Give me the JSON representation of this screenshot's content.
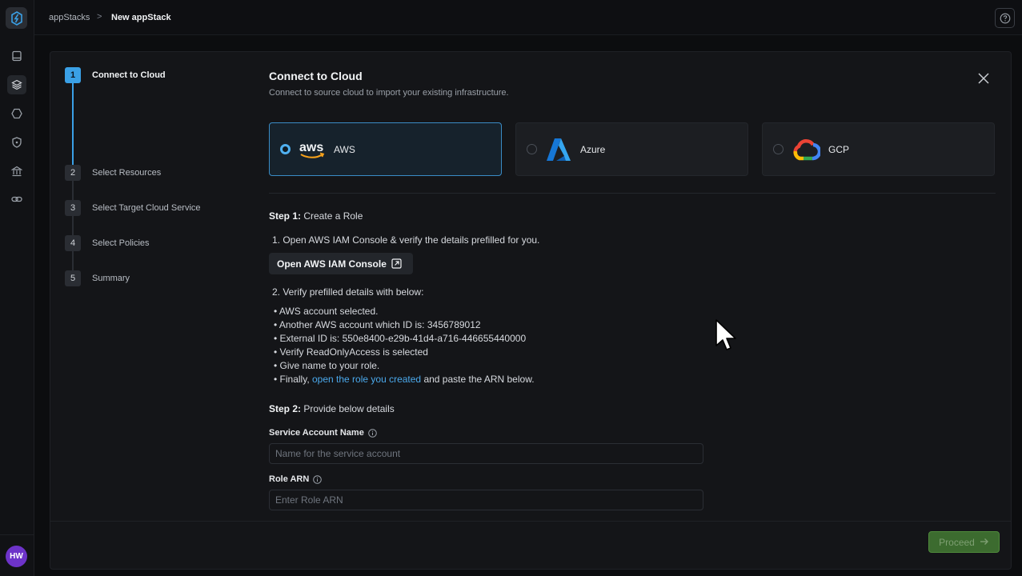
{
  "breadcrumb": {
    "root": "appStacks",
    "separator": ">",
    "current": "New appStack"
  },
  "user": {
    "initials": "HW"
  },
  "stepper": {
    "steps": [
      {
        "num": "1",
        "label": "Connect to Cloud",
        "active": true
      },
      {
        "num": "2",
        "label": "Select Resources"
      },
      {
        "num": "3",
        "label": "Select Target Cloud Service"
      },
      {
        "num": "4",
        "label": "Select Policies"
      },
      {
        "num": "5",
        "label": "Summary"
      }
    ]
  },
  "header": {
    "title": "Connect to Cloud",
    "subtitle": "Connect to source cloud to import your existing infrastructure."
  },
  "clouds": [
    {
      "name": "AWS",
      "logo_text": "aws",
      "selected": true
    },
    {
      "name": "Azure",
      "selected": false
    },
    {
      "name": "GCP",
      "selected": false
    }
  ],
  "step1": {
    "heading_bold": "Step 1:",
    "heading_rest": " Create a Role",
    "item1": "1. Open AWS IAM Console & verify the details prefilled for you.",
    "console_button": "Open AWS IAM Console",
    "item2": "2. Verify prefilled details with below:",
    "bullets": [
      "AWS account selected.",
      "Another AWS account which ID is: 3456789012",
      "External ID is: 550e8400-e29b-41d4-a716-446655440000",
      "Verify ReadOnlyAccess is selected",
      "Give name to your role."
    ],
    "final_prefix": "Finally, ",
    "final_link": "open the role you created",
    "final_suffix": " and paste the ARN below."
  },
  "step2": {
    "heading_bold": "Step 2:",
    "heading_rest": " Provide below details",
    "service_account": {
      "label": "Service Account Name",
      "placeholder": "Name for the service account"
    },
    "role_arn": {
      "label": "Role ARN",
      "placeholder": "Enter Role ARN"
    }
  },
  "footer": {
    "proceed_label": "Proceed"
  },
  "colors": {
    "accent": "#3aa0e6",
    "proceed": "#3c6b2f",
    "avatar": "#6d33c9"
  }
}
